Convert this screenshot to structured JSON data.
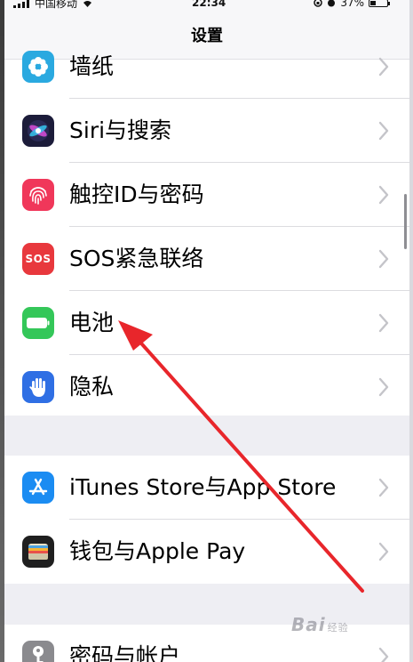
{
  "status": {
    "carrier": "中国移动",
    "time": "22:34",
    "battery": "37%"
  },
  "nav": {
    "title": "设置"
  },
  "groups": [
    {
      "items": [
        {
          "label": "墙纸",
          "icon": "wallpaper-icon",
          "color": "#2aa9e0"
        },
        {
          "label": "Siri与搜索",
          "icon": "siri-icon",
          "color": "#1c1c3a"
        },
        {
          "label": "触控ID与密码",
          "icon": "fingerprint-icon",
          "color": "#f0375a"
        },
        {
          "label": "SOS紧急联络",
          "icon": "sos-icon",
          "color": "#e8383d",
          "icon_text": "SOS"
        },
        {
          "label": "电池",
          "icon": "battery-icon",
          "color": "#34c759"
        },
        {
          "label": "隐私",
          "icon": "hand-icon",
          "color": "#2f6fe4"
        }
      ]
    },
    {
      "items": [
        {
          "label": "iTunes Store与App Store",
          "icon": "app-store-icon",
          "color": "#1b8cf2"
        },
        {
          "label": "钱包与Apple Pay",
          "icon": "wallet-icon",
          "color": "#1f1f1f"
        }
      ]
    },
    {
      "items": [
        {
          "label": "密码与帐户",
          "icon": "key-icon",
          "color": "#8a8a8e"
        }
      ]
    }
  ],
  "watermark": {
    "brand": "Bai",
    "suffix": "经验"
  },
  "colors": {
    "arrow": "#e8262b",
    "chevron": "#c4c4c9"
  }
}
